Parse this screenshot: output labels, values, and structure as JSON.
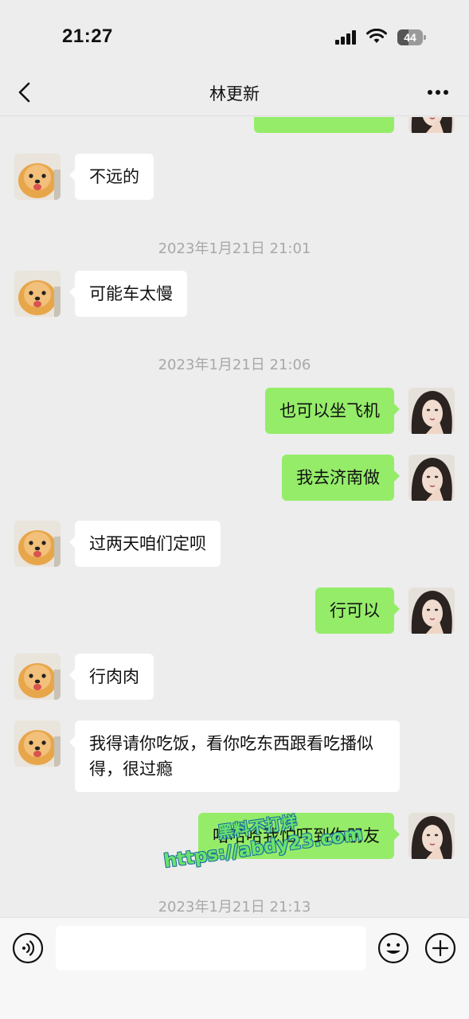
{
  "status_bar": {
    "time": "21:27",
    "battery_level": "44",
    "icons": [
      "cellular-signal-icon",
      "wifi-icon",
      "battery-icon"
    ]
  },
  "nav": {
    "title": "林更新",
    "back_icon": "chevron-left-icon",
    "more_icon": "more-dots-icon"
  },
  "messages": [
    {
      "type": "msg",
      "side": "right",
      "text": ""
    },
    {
      "type": "msg",
      "side": "left",
      "text": "不远的"
    },
    {
      "type": "time",
      "text": "2023年1月21日 21:01"
    },
    {
      "type": "msg",
      "side": "left",
      "text": "可能车太慢"
    },
    {
      "type": "time",
      "text": "2023年1月21日 21:06"
    },
    {
      "type": "msg",
      "side": "right",
      "text": "也可以坐飞机"
    },
    {
      "type": "msg",
      "side": "right",
      "text": "我去济南做"
    },
    {
      "type": "msg",
      "side": "left",
      "text": "过两天咱们定呗"
    },
    {
      "type": "msg",
      "side": "right",
      "text": "行可以"
    },
    {
      "type": "msg",
      "side": "left",
      "text": "行肉肉"
    },
    {
      "type": "msg",
      "side": "left",
      "text": "我得请你吃饭，看你吃东西跟看吃播似得，很过瘾"
    },
    {
      "type": "msg",
      "side": "right",
      "text": "哈哈哈我怕吓到你朋友"
    },
    {
      "type": "time",
      "text": "2023年1月21日 21:13"
    }
  ],
  "watermark": {
    "line1": "黑料不打烊",
    "line2": "https://abdy23.com"
  },
  "input_bar": {
    "placeholder": "",
    "icons": [
      "voice-icon",
      "emoji-icon",
      "plus-icon"
    ]
  },
  "colors": {
    "background": "#ededed",
    "sent_bubble": "#95ec69",
    "received_bubble": "#ffffff",
    "timestamp": "#a8a8a8"
  }
}
